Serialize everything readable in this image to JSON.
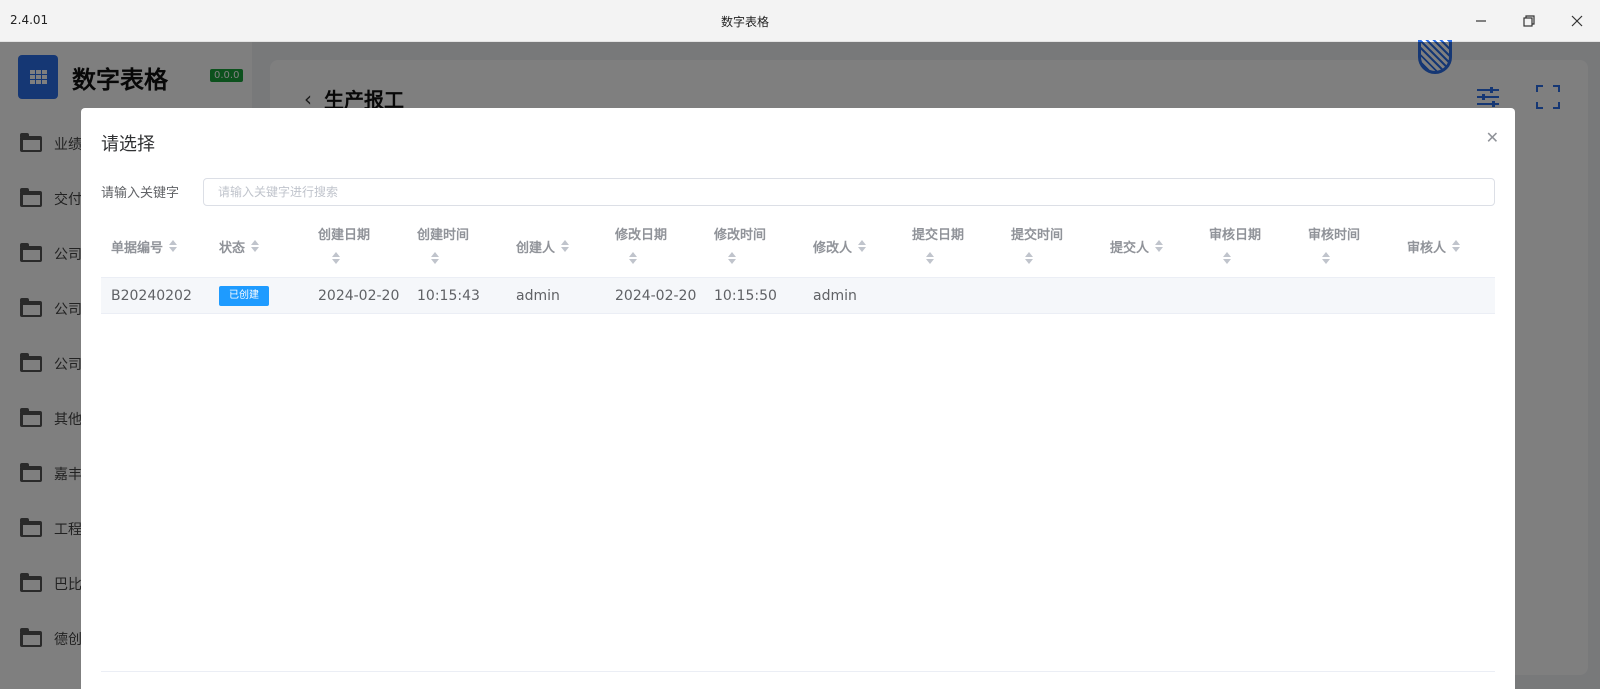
{
  "window": {
    "version": "2.4.01",
    "title": "数字表格"
  },
  "sidebar": {
    "app_name": "数字表格",
    "badge": "0.0.0",
    "items": [
      {
        "label": "业绩"
      },
      {
        "label": "交付"
      },
      {
        "label": "公司"
      },
      {
        "label": "公司"
      },
      {
        "label": "公司"
      },
      {
        "label": "其他"
      },
      {
        "label": "嘉丰"
      },
      {
        "label": "工程"
      },
      {
        "label": "巴比"
      },
      {
        "label": "德创"
      }
    ]
  },
  "page": {
    "title": "生产报工"
  },
  "dialog": {
    "title": "请选择",
    "search_label": "请输入关键字",
    "search_placeholder": "请输入关键字进行搜索",
    "search_value": "",
    "columns": [
      {
        "label": "单据编号"
      },
      {
        "label": "状态"
      },
      {
        "label": "创建日期"
      },
      {
        "label": "创建时间"
      },
      {
        "label": "创建人"
      },
      {
        "label": "修改日期"
      },
      {
        "label": "修改时间"
      },
      {
        "label": "修改人"
      },
      {
        "label": "提交日期"
      },
      {
        "label": "提交时间"
      },
      {
        "label": "提交人"
      },
      {
        "label": "审核日期"
      },
      {
        "label": "审核时间"
      },
      {
        "label": "审核人"
      }
    ],
    "rows": [
      {
        "doc_no": "B20240202",
        "status": "已创建",
        "created_date": "2024-02-20",
        "created_time": "10:15:43",
        "creator": "admin",
        "modified_date": "2024-02-20",
        "modified_time": "10:15:50",
        "modifier": "admin",
        "submitted_date": "",
        "submitted_time": "",
        "submitter": "",
        "reviewed_date": "",
        "reviewed_time": "",
        "reviewer": ""
      }
    ]
  },
  "colors": {
    "status_tag": "#1e9bff",
    "brand": "#2a6ee8",
    "badge": "#18a33a"
  },
  "icons": [
    "minimize-icon",
    "restore-icon",
    "close-icon",
    "folder-icon",
    "back-arrow-icon",
    "filter-settings-icon",
    "fullscreen-icon",
    "sort-icon",
    "qr-code-icon"
  ]
}
